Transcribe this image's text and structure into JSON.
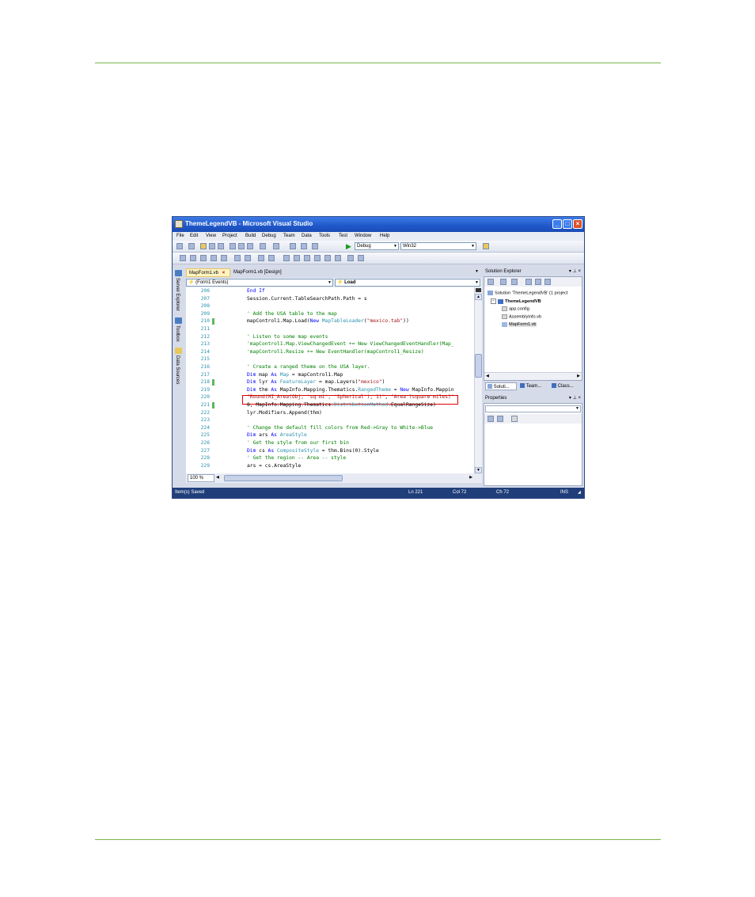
{
  "window": {
    "title": "ThemeLegendVB - Microsoft Visual Studio",
    "minimize": "_",
    "maximize": "□",
    "close": "×"
  },
  "menu": [
    "File",
    "Edit",
    "View",
    "Project",
    "Build",
    "Debug",
    "Team",
    "Data",
    "Tools",
    "Test",
    "Window",
    "Help"
  ],
  "toolbar": {
    "config": "Debug",
    "platform": "Win32"
  },
  "side_tabs": [
    "Server Explorer",
    "Toolbox",
    "Data Sources"
  ],
  "editor": {
    "tabs": [
      "MapForm1.vb",
      "MapForm1.vb [Design]"
    ],
    "object_combo": "(Form1 Events)",
    "method_combo": "Load",
    "zoom": "100 %",
    "lines": [
      {
        "n": "206",
        "indent": 0,
        "parts": [
          [
            "kw",
            "End If"
          ]
        ]
      },
      {
        "n": "207",
        "indent": 0,
        "parts": [
          [
            "",
            "Session.Current.TableSearchPath.Path = s"
          ]
        ]
      },
      {
        "n": "208",
        "indent": 0,
        "parts": []
      },
      {
        "n": "209",
        "indent": 0,
        "parts": [
          [
            "cm",
            "' Add the USA table to the map"
          ]
        ]
      },
      {
        "n": "210",
        "indent": 0,
        "mark": true,
        "parts": [
          [
            "",
            "mapControl1.Map.Load("
          ],
          [
            "kw",
            "New "
          ],
          [
            "ty",
            "MapTableLoader"
          ],
          [
            "",
            "("
          ],
          [
            "st",
            "\"mexico.tab\""
          ],
          [
            "",
            "))"
          ]
        ]
      },
      {
        "n": "211",
        "indent": 0,
        "parts": []
      },
      {
        "n": "212",
        "indent": 0,
        "parts": [
          [
            "cm",
            "' Listen to some map events"
          ]
        ]
      },
      {
        "n": "213",
        "indent": 0,
        "parts": [
          [
            "cm",
            "'mapControl1.Map.ViewChangedEvent += New ViewChangedEventHandler(Map_"
          ]
        ]
      },
      {
        "n": "214",
        "indent": 0,
        "parts": [
          [
            "cm",
            "'mapControl1.Resize += New EventHandler(mapControl1_Resize)"
          ]
        ]
      },
      {
        "n": "215",
        "indent": 0,
        "parts": []
      },
      {
        "n": "216",
        "indent": 0,
        "parts": [
          [
            "cm",
            "' Create a ranged theme on the USA layer."
          ]
        ]
      },
      {
        "n": "217",
        "indent": 0,
        "parts": [
          [
            "kw",
            "Dim "
          ],
          [
            "",
            "map "
          ],
          [
            "kw",
            "As "
          ],
          [
            "ty",
            "Map"
          ],
          [
            "",
            " = mapControl1.Map"
          ]
        ]
      },
      {
        "n": "218",
        "indent": 0,
        "mark": true,
        "parts": [
          [
            "kw",
            "Dim "
          ],
          [
            "",
            "lyr "
          ],
          [
            "kw",
            "As "
          ],
          [
            "ty",
            "FeatureLayer"
          ],
          [
            "",
            " = map.Layers("
          ],
          [
            "st",
            "\"mexico\""
          ],
          [
            "",
            ")"
          ]
        ]
      },
      {
        "n": "219",
        "indent": 0,
        "parts": [
          [
            "kw",
            "Dim "
          ],
          [
            "",
            "thm "
          ],
          [
            "kw",
            "As "
          ],
          [
            "",
            "MapInfo.Mapping.Thematics."
          ],
          [
            "ty",
            "RangedTheme"
          ],
          [
            "",
            " = "
          ],
          [
            "kw",
            "New "
          ],
          [
            "",
            "MapInfo.Mappin"
          ]
        ]
      },
      {
        "n": "220",
        "indent": 0,
        "parts": [
          [
            "st",
            "\"Round(MI_Area(Obj, 'sq mi', 'Spherical'), 1)\""
          ],
          [
            "",
            ", "
          ],
          [
            "st",
            "\"Area (square miles)\""
          ]
        ]
      },
      {
        "n": "221",
        "indent": 0,
        "mark": true,
        "parts": [
          [
            "",
            "8, MapInfo.Mapping.Thematics."
          ],
          [
            "ty",
            "DistributionMethod"
          ],
          [
            "",
            ".EqualRangeSize)"
          ]
        ]
      },
      {
        "n": "222",
        "indent": 0,
        "parts": [
          [
            "",
            "lyr.Modifiers.Append(thm)"
          ]
        ]
      },
      {
        "n": "223",
        "indent": 0,
        "parts": []
      },
      {
        "n": "224",
        "indent": 0,
        "parts": [
          [
            "cm",
            "' Change the default fill colors from Red->Gray to White->Blue"
          ]
        ]
      },
      {
        "n": "225",
        "indent": 0,
        "parts": [
          [
            "kw",
            "Dim "
          ],
          [
            "",
            "ars "
          ],
          [
            "kw",
            "As "
          ],
          [
            "ty",
            "AreaStyle"
          ]
        ]
      },
      {
        "n": "226",
        "indent": 0,
        "parts": [
          [
            "cm",
            "' Get the style from our first bin"
          ]
        ]
      },
      {
        "n": "227",
        "indent": 0,
        "parts": [
          [
            "kw",
            "Dim "
          ],
          [
            "",
            "cs "
          ],
          [
            "kw",
            "As "
          ],
          [
            "ty",
            "CompositeStyle"
          ],
          [
            "",
            " = thm.Bins(0).Style"
          ]
        ]
      },
      {
        "n": "228",
        "indent": 0,
        "parts": [
          [
            "cm",
            "' Get the region -- Area -- style"
          ]
        ]
      },
      {
        "n": "229",
        "indent": 0,
        "parts": [
          [
            "",
            "ars = cs.AreaStyle"
          ]
        ]
      }
    ]
  },
  "solution_explorer": {
    "title": "Solution Explorer",
    "pin": "▾ ⊥ ×",
    "items": [
      {
        "label": "Solution 'ThemeLegendVB' (1 project",
        "level": 0,
        "bold": false
      },
      {
        "label": "ThemeLegendVB",
        "level": 1,
        "bold": true
      },
      {
        "label": "app.config",
        "level": 2,
        "bold": false
      },
      {
        "label": "AssemblyInfo.vb",
        "level": 2,
        "bold": false
      },
      {
        "label": "MapForm1.vb",
        "level": 2,
        "bold": false
      }
    ],
    "tabs": [
      "Soluti...",
      "Team...",
      "Class..."
    ]
  },
  "properties": {
    "title": "Properties",
    "pin": "▾ ⊥ ×"
  },
  "status": {
    "message": "Item(s) Saved",
    "ln": "Ln 221",
    "col": "Col 72",
    "ch": "Ch 72",
    "mode": "INS"
  },
  "colors": {
    "rule": "#7ab648",
    "keyword": "#0000ff",
    "comment": "#008000",
    "string": "#a31515",
    "type": "#2b91af",
    "highlight_box": "#e00000"
  }
}
